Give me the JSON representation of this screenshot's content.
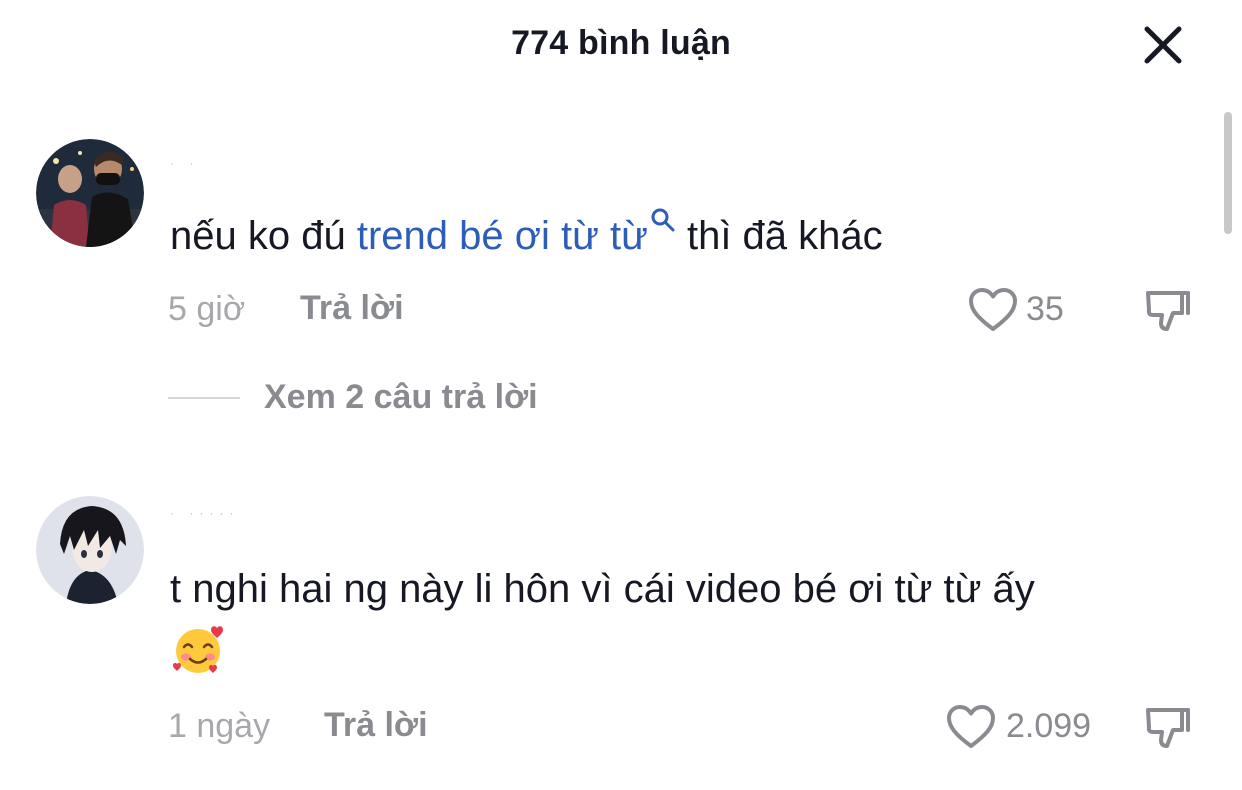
{
  "header": {
    "title": "774 bình luận"
  },
  "comments": [
    {
      "text_before": "nếu ko đú ",
      "hashtag": "trend bé ơi từ từ",
      "text_after": " thì đã khác",
      "time": "5 giờ",
      "reply_label": "Trả lời",
      "likes": "35",
      "view_replies": "Xem 2 câu trả lời"
    },
    {
      "text": "t nghi hai ng này li hôn vì cái video bé ơi từ từ ấy",
      "emoji": "smiling-face-with-hearts",
      "time": "1 ngày",
      "reply_label": "Trả lời",
      "likes": "2.099"
    }
  ],
  "colors": {
    "hashtag": "#2b5db9",
    "meta": "#8a8b91",
    "text": "#161823"
  }
}
